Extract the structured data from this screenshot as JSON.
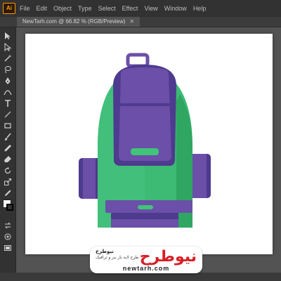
{
  "app": {
    "logo": "Ai"
  },
  "menubar": {
    "items": [
      {
        "label": "File"
      },
      {
        "label": "Edit"
      },
      {
        "label": "Object"
      },
      {
        "label": "Type"
      },
      {
        "label": "Select"
      },
      {
        "label": "Effect"
      },
      {
        "label": "View"
      },
      {
        "label": "Window"
      },
      {
        "label": "Help"
      }
    ]
  },
  "document_tab": {
    "title": "NewTarh.com @ 66.82 % (RGB/Preview)"
  },
  "toolbar": {
    "tools": [
      {
        "icon": "selection-tool-icon"
      },
      {
        "icon": "direct-selection-tool-icon"
      },
      {
        "icon": "magic-wand-icon"
      },
      {
        "icon": "lasso-icon"
      },
      {
        "icon": "pen-tool-icon"
      },
      {
        "icon": "curvature-tool-icon"
      },
      {
        "icon": "type-tool-icon"
      },
      {
        "icon": "line-tool-icon"
      },
      {
        "icon": "rectangle-tool-icon"
      },
      {
        "icon": "paintbrush-icon"
      },
      {
        "icon": "pencil-icon"
      },
      {
        "icon": "eraser-icon"
      },
      {
        "icon": "rotate-tool-icon"
      },
      {
        "icon": "scale-tool-icon"
      },
      {
        "icon": "warp-tool-icon"
      },
      {
        "icon": "free-transform-icon"
      },
      {
        "icon": "shape-builder-icon"
      },
      {
        "icon": "eyedropper-icon"
      },
      {
        "icon": "blend-tool-icon"
      },
      {
        "icon": "artboard-tool-icon"
      }
    ]
  },
  "artwork": {
    "subject": "backpack",
    "colors": {
      "green": "#3dba74",
      "green_dark": "#2fa662",
      "purple": "#6b4fa8",
      "purple_dark": "#4e3a8e",
      "strip": "#3fc47a"
    }
  },
  "watermark": {
    "brand": "نیوطرح",
    "title": "نیوطرح",
    "subtitle": "دانلود طرح لایه باز بنر و ترافیک",
    "domain": "newtarh.com"
  }
}
